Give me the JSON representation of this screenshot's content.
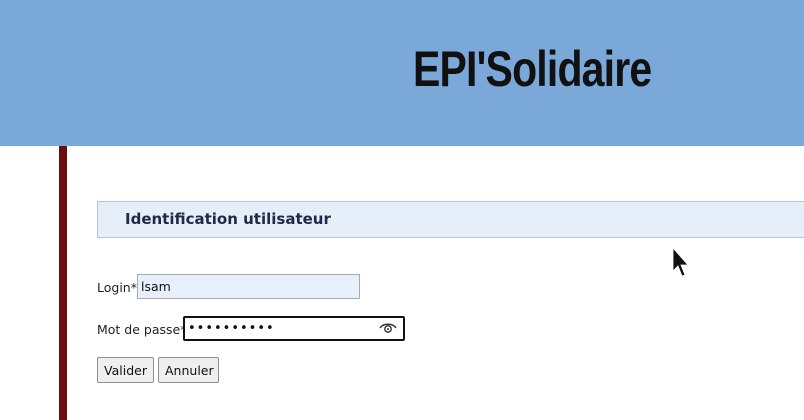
{
  "header": {
    "brand": "EPI'Solidaire",
    "background_color": "#7aa8d8"
  },
  "section": {
    "title": "Identification utilisateur"
  },
  "form": {
    "login_label": "Login*",
    "login_value": "lsam",
    "password_label": "Mot de passe*",
    "password_value": "••••••••••"
  },
  "buttons": {
    "validate": "Valider",
    "cancel": "Annuler"
  },
  "icons": {
    "reveal_password": "eye-icon",
    "cursor": "mouse-pointer-icon"
  },
  "colors": {
    "accent_border": "#6e0b0b",
    "section_bg": "#e6eef9",
    "autofill_bg": "#e8f0fe"
  }
}
